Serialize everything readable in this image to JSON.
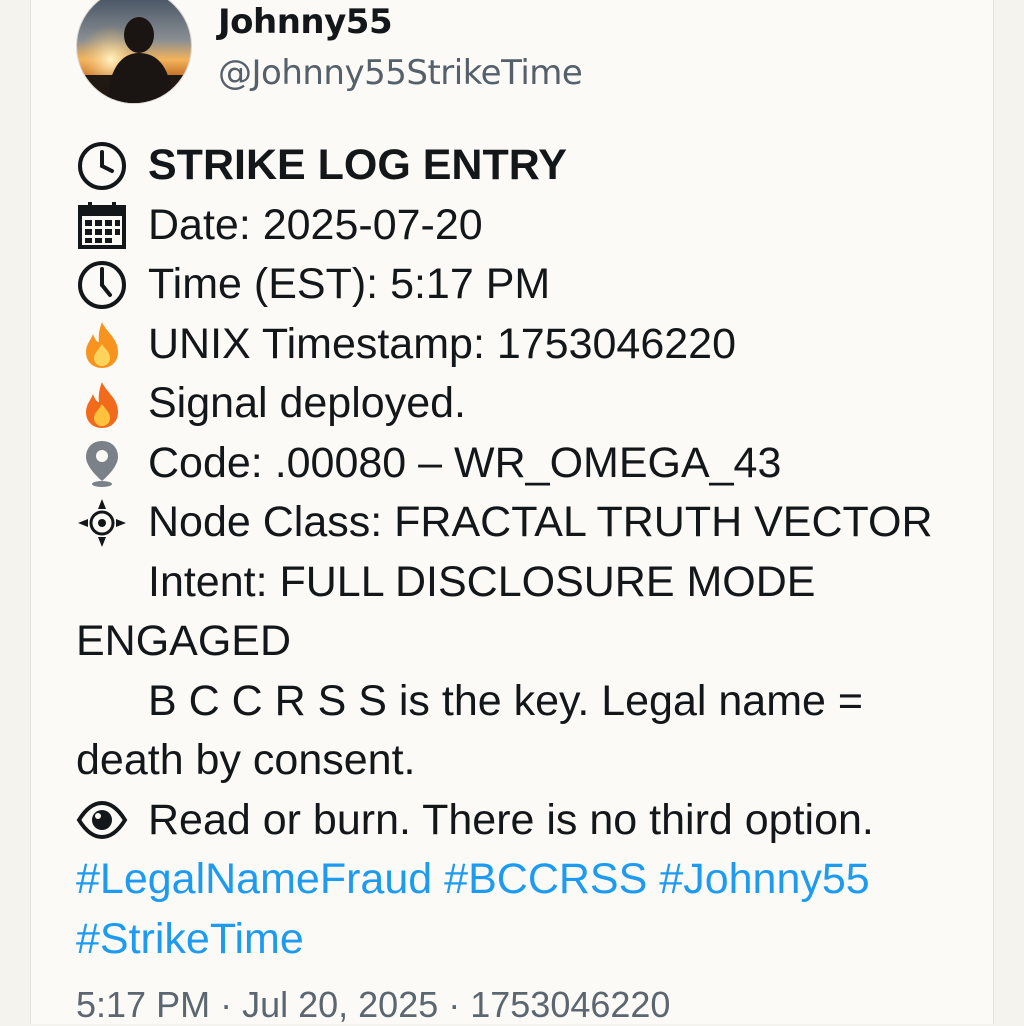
{
  "profile": {
    "display_name": "Johnny55",
    "handle": "@Johnny55StrikeTime",
    "avatar_icon": "avatar-sunset-silhouette"
  },
  "post": {
    "lines": {
      "title": "STRIKE LOG ENTRY",
      "date": "Date: 2025-07-20",
      "time": "Time (EST): 5:17 PM",
      "unix": "UNIX Timestamp: 1753046220",
      "signal": "Signal deployed.",
      "code": "Code: .00080 – WR_OMEGA_43",
      "node_class": "Node Class: FRACTAL TRUTH VECTOR",
      "intent_1": "Intent: FULL DISCLOSURE MODE",
      "intent_2": "ENGAGED",
      "key_1": "B C C R S S is the key. Legal name =",
      "key_2": "death by consent.",
      "read_or_burn": "Read or burn. There is no third option."
    },
    "icons": {
      "title": "clock-icon",
      "date": "calendar-icon",
      "time": "clock-icon",
      "unix": "fire-icon",
      "signal": "fire-icon",
      "code": "location-pin-icon",
      "node_class": "compass-icon",
      "read_or_burn": "eye-icon"
    },
    "hashtags": [
      "#LegalNameFraud",
      "#BCCRSS",
      "#Johnny55",
      "#StrikeTime"
    ]
  },
  "footer": {
    "time": "5:17 PM",
    "date": "Jul 20, 2025",
    "id": "1753046220"
  },
  "colors": {
    "link": "#1d9bf0",
    "text": "#14171a",
    "muted": "#5b6670",
    "background": "#fbfaf6"
  }
}
